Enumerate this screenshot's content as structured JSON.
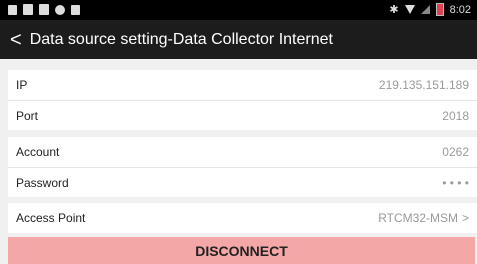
{
  "status_bar": {
    "time": "8:02"
  },
  "header": {
    "back_symbol": "<",
    "title": "Data source setting-Data Collector Internet"
  },
  "fields": {
    "ip": {
      "label": "IP",
      "value": "219.135.151.189"
    },
    "port": {
      "label": "Port",
      "value": "2018"
    },
    "account": {
      "label": "Account",
      "value": "0262"
    },
    "password": {
      "label": "Password",
      "value": "• • • •"
    },
    "access_point": {
      "label": "Access Point",
      "value": "RTCM32-MSM",
      "chevron": ">"
    }
  },
  "actions": {
    "disconnect_label": "DISCONNECT"
  },
  "colors": {
    "header_bg": "#1c1c1c",
    "disconnect_bg": "#f4a7a7"
  }
}
